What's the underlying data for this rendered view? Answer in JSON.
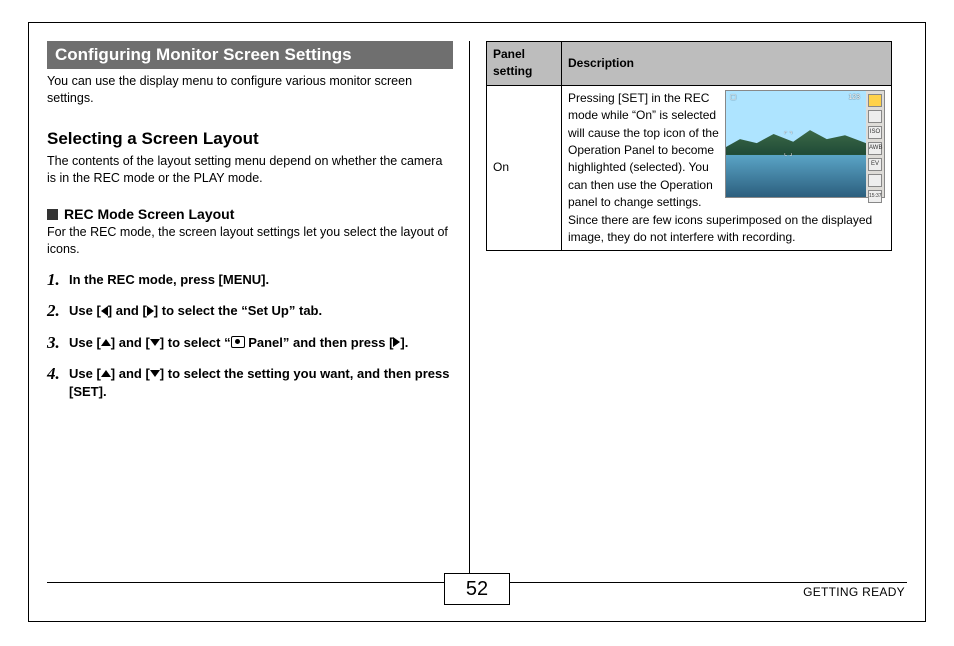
{
  "left": {
    "banner": "Configuring Monitor Screen Settings",
    "intro": "You can use the display menu to configure various monitor screen settings.",
    "section_title": "Selecting a Screen Layout",
    "section_body": "The contents of the layout setting menu depend on whether the camera is in the REC mode or the PLAY mode.",
    "subhead": "REC Mode Screen Layout",
    "subhead_body": "For the REC mode, the screen layout settings let you select the layout of icons.",
    "steps": {
      "s1": "In the REC mode, press [MENU].",
      "s2a": "Use [",
      "s2b": "] and [",
      "s2c": "] to select the “Set Up” tab.",
      "s3a": "Use [",
      "s3b": "] and [",
      "s3c": "] to select “",
      "s3d": " Panel” and then press [",
      "s3e": "].",
      "s4a": "Use [",
      "s4b": "] and [",
      "s4c": "] to select the setting you want, and then press [SET]."
    }
  },
  "right": {
    "table": {
      "h1": "Panel setting",
      "h2": "Description",
      "row1_setting": "On",
      "row1_desc_a": "Pressing [SET] in the REC mode while “On” is selected will cause the top icon of the Operation Panel to become ",
      "row1_desc_b": "highlighted (selected). You can then use the Operation panel to change settings. Since there are few icons superimposed on the displayed image, they do not interfere with recording."
    },
    "lcd": {
      "count": "123",
      "iso": "ISO",
      "awb": "AWB",
      "ev": "EV",
      "time": "15:37"
    }
  },
  "footer": {
    "page": "52",
    "section": "GETTING READY"
  }
}
